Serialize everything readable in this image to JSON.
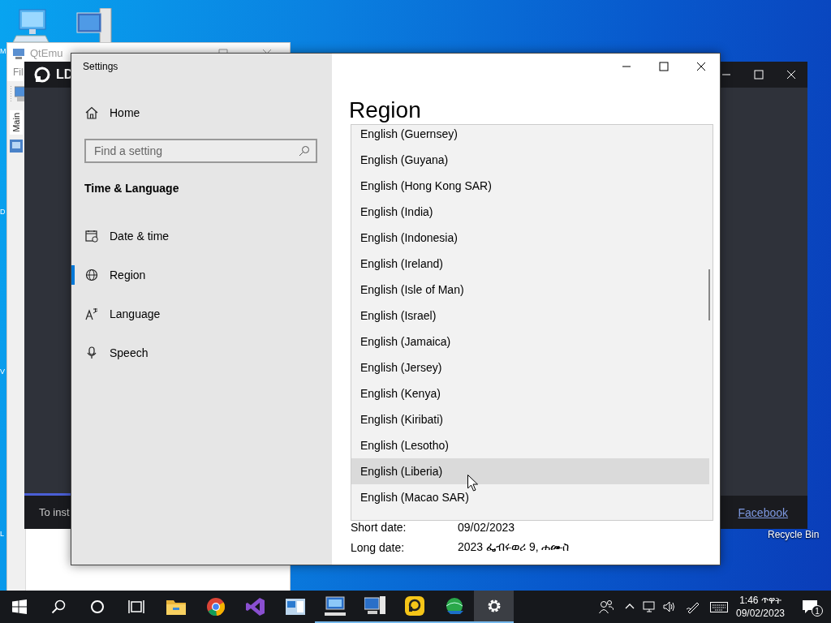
{
  "desktop": {
    "label_fragments": [
      "M",
      "D",
      "V",
      "L"
    ],
    "recycle_bin_label": "Recycle Bin"
  },
  "qtemu_window": {
    "title": "QtEmu",
    "menu": "Fil",
    "tab": "Main"
  },
  "ldplayer_window": {
    "title": "LD",
    "footer_text": "To inst",
    "link": "Facebook"
  },
  "settings_window": {
    "title": "Settings",
    "home": "Home",
    "search": {
      "placeholder": "Find a setting"
    },
    "section": "Time & Language",
    "nav_items": [
      {
        "kind": "calendar",
        "label": "Date & time",
        "selected": false
      },
      {
        "kind": "globe",
        "label": "Region",
        "selected": true
      },
      {
        "kind": "language",
        "label": "Language",
        "selected": false
      },
      {
        "kind": "microphone",
        "label": "Speech",
        "selected": false
      }
    ],
    "page_title": "Region",
    "region_list": [
      {
        "label": "English (Guernsey)",
        "highlighted": false
      },
      {
        "label": "English (Guyana)",
        "highlighted": false
      },
      {
        "label": "English (Hong Kong SAR)",
        "highlighted": false
      },
      {
        "label": "English (India)",
        "highlighted": false
      },
      {
        "label": "English (Indonesia)",
        "highlighted": false
      },
      {
        "label": "English (Ireland)",
        "highlighted": false
      },
      {
        "label": "English (Isle of Man)",
        "highlighted": false
      },
      {
        "label": "English (Israel)",
        "highlighted": false
      },
      {
        "label": "English (Jamaica)",
        "highlighted": false
      },
      {
        "label": "English (Jersey)",
        "highlighted": false
      },
      {
        "label": "English (Kenya)",
        "highlighted": false
      },
      {
        "label": "English (Kiribati)",
        "highlighted": false
      },
      {
        "label": "English (Lesotho)",
        "highlighted": false
      },
      {
        "label": "English (Liberia)",
        "highlighted": true
      },
      {
        "label": "English (Macao SAR)",
        "highlighted": false
      }
    ],
    "formats": [
      {
        "label": "Short date:",
        "value": "09/02/2023"
      },
      {
        "label": "Long date:",
        "value": "2023 ፌብሩወሪ 9, ሐሙስ"
      }
    ]
  },
  "taskbar": {
    "apps": [
      {
        "kind": "start",
        "running": false,
        "selected": false
      },
      {
        "kind": "search",
        "running": false,
        "selected": false
      },
      {
        "kind": "cortana",
        "running": false,
        "selected": false
      },
      {
        "kind": "taskview",
        "running": false,
        "selected": false
      },
      {
        "kind": "explorer",
        "running": false,
        "selected": false
      },
      {
        "kind": "browser",
        "running": false,
        "selected": false
      },
      {
        "kind": "ide",
        "running": false,
        "selected": false
      },
      {
        "kind": "window",
        "running": false,
        "selected": false
      },
      {
        "kind": "remote",
        "running": true,
        "selected": false
      },
      {
        "kind": "computer",
        "running": true,
        "selected": false
      },
      {
        "kind": "player",
        "running": true,
        "selected": false
      },
      {
        "kind": "globe",
        "running": true,
        "selected": false
      },
      {
        "kind": "settings",
        "running": true,
        "selected": true
      }
    ],
    "clock": {
      "time": "1:46 ጥዋት",
      "date": "09/02/2023"
    },
    "notification_count": "1"
  }
}
